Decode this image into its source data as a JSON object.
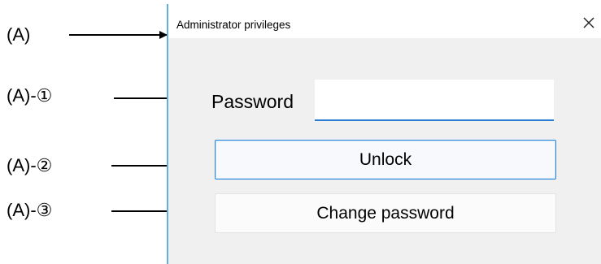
{
  "annotations": {
    "a": "(A)",
    "a1": "(A)-①",
    "a2": "(A)-②",
    "a3": "(A)-③"
  },
  "dialog": {
    "title": "Administrator privileges",
    "close_icon": "close-icon",
    "password_label": "Password",
    "password_value": "",
    "unlock_label": "Unlock",
    "change_password_label": "Change password"
  },
  "colors": {
    "dialog_border": "#5fb0dc",
    "input_underline": "#2b7cd3",
    "focused_button_border": "#2a86d8",
    "dialog_background": "#f0f0f0"
  }
}
